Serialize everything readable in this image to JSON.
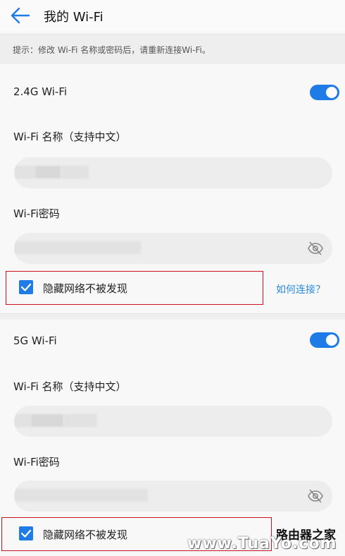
{
  "header": {
    "title": "我的 Wi-Fi",
    "back_icon": "arrow-left-icon"
  },
  "tip": {
    "text": "提示：修改 Wi-Fi 名称或密码后，请重新连接Wi-Fi。"
  },
  "band_24": {
    "label": "2.4G Wi-Fi",
    "enabled": true,
    "name_label": "Wi-Fi 名称（支持中文）",
    "name_value": "",
    "password_label": "Wi-Fi密码",
    "password_value": "",
    "hide_network_label": "隐藏网络不被发现",
    "hide_network_checked": true,
    "how_to_connect": "如何连接？"
  },
  "band_5": {
    "label": "5G Wi-Fi",
    "enabled": true,
    "name_label": "Wi-Fi 名称（支持中文）",
    "name_value": "",
    "password_label": "Wi-Fi密码",
    "password_value": "",
    "hide_network_label": "隐藏网络不被发现",
    "hide_network_checked": true
  },
  "watermark": {
    "line1": "路由器之家",
    "line2": "www.TuaYo.com"
  },
  "colors": {
    "accent": "#1f7ce7",
    "highlight_border": "#c8141d",
    "link": "#2b8ad8"
  }
}
